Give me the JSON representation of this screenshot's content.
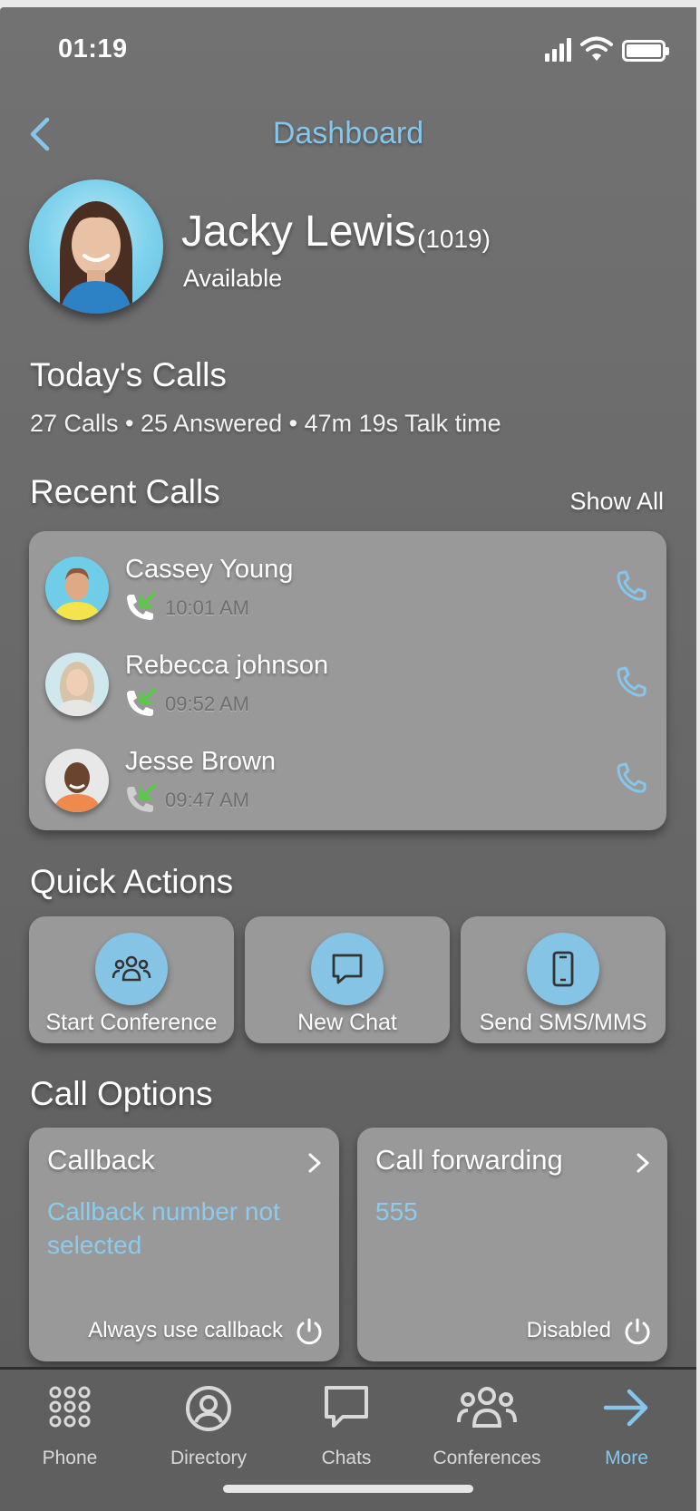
{
  "status_bar": {
    "time": "01:19"
  },
  "header": {
    "title": "Dashboard",
    "back_icon": "chevron-left-icon"
  },
  "profile": {
    "name": "Jacky Lewis",
    "extension": "(1019)",
    "status": "Available"
  },
  "todays_calls": {
    "title": "Today's Calls",
    "summary": "27 Calls • 25 Answered • 47m  19s Talk time"
  },
  "recent_calls": {
    "title": "Recent Calls",
    "show_all": "Show All",
    "items": [
      {
        "name": "Cassey Young",
        "time": "10:01 AM"
      },
      {
        "name": "Rebecca johnson",
        "time": "09:52 AM"
      },
      {
        "name": "Jesse Brown",
        "time": "09:47 AM"
      }
    ]
  },
  "quick_actions": {
    "title": "Quick Actions",
    "items": [
      {
        "label": "Start Conference",
        "icon": "group-icon"
      },
      {
        "label": "New Chat",
        "icon": "chat-bubble-icon"
      },
      {
        "label": "Send SMS/MMS",
        "icon": "mobile-phone-icon"
      }
    ]
  },
  "call_options": {
    "title": "Call Options",
    "callback": {
      "title": "Callback",
      "value": "Callback number not selected",
      "footer": "Always use callback"
    },
    "forwarding": {
      "title": "Call forwarding",
      "value": "555",
      "footer": "Disabled"
    }
  },
  "tabbar": {
    "items": [
      {
        "label": "Phone",
        "icon": "dialpad-icon"
      },
      {
        "label": "Directory",
        "icon": "person-circle-icon"
      },
      {
        "label": "Chats",
        "icon": "chat-bubble-icon"
      },
      {
        "label": "Conferences",
        "icon": "group-icon"
      },
      {
        "label": "More",
        "icon": "arrow-right-icon",
        "active": true
      }
    ]
  },
  "colors": {
    "accent": "#86c6ec",
    "card": "#999999",
    "background": "#6a6a6a",
    "incoming_green": "#5cc84a"
  }
}
